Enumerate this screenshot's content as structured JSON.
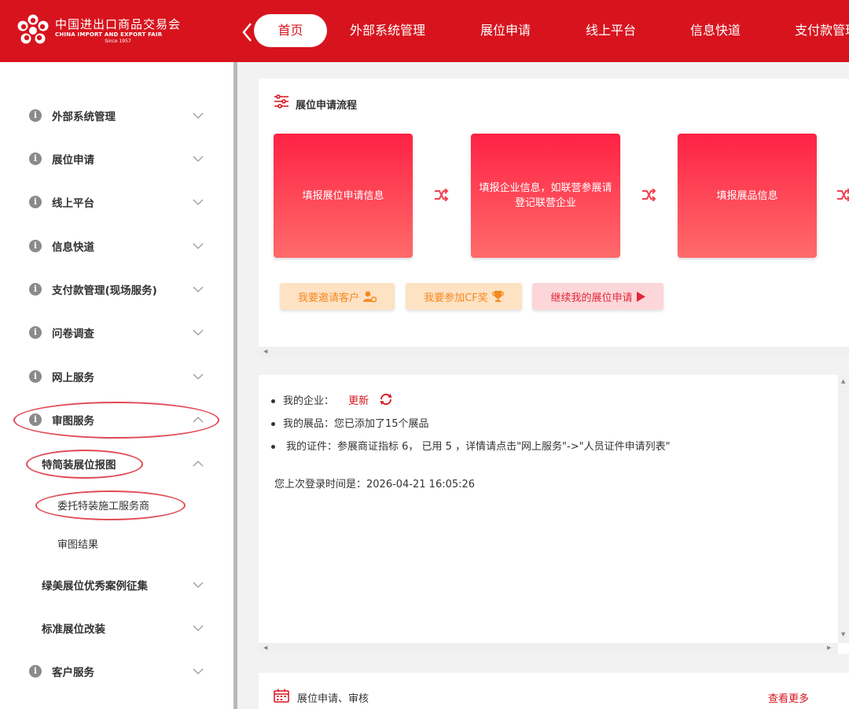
{
  "header": {
    "logo_cn": "中国进出口商品交易会",
    "logo_en": "CHINA IMPORT AND EXPORT FAIR",
    "logo_since": "Since 1957",
    "nav": [
      "首页",
      "外部系统管理",
      "展位申请",
      "线上平台",
      "信息快道",
      "支付款管理"
    ]
  },
  "sidebar": {
    "items": [
      {
        "label": "外部系统管理",
        "expanded": false
      },
      {
        "label": "展位申请",
        "expanded": false
      },
      {
        "label": "线上平台",
        "expanded": false
      },
      {
        "label": "信息快道",
        "expanded": false
      },
      {
        "label": "支付款管理(现场服务)",
        "expanded": false
      },
      {
        "label": "问卷调查",
        "expanded": false
      },
      {
        "label": "网上服务",
        "expanded": false
      },
      {
        "label": "审图服务",
        "expanded": true
      },
      {
        "label": "特简装展位报图",
        "expanded": true
      },
      {
        "label": "委托特装施工服务商"
      },
      {
        "label": "审图结果"
      },
      {
        "label": "绿美展位优秀案例征集",
        "expanded": false
      },
      {
        "label": "标准展位改装",
        "expanded": false
      },
      {
        "label": "客户服务",
        "expanded": false
      }
    ]
  },
  "flow": {
    "title": "展位申请流程",
    "steps": [
      "填报展位申请信息",
      "填报企业信息，如联营参展请登记联营企业",
      "填报展品信息"
    ],
    "buttons": [
      "我要邀请客户",
      "我要参加CF奖",
      "继续我的展位申请"
    ]
  },
  "info": {
    "company_label": "我的企业：",
    "company_link": "更新",
    "exhibits": "我的展品：您已添加了15个展品",
    "certs": "我的证件：参展商证指标 6， 已用 5 ，详情请点击\"网上服务\"->\"人员证件申请列表\"",
    "last_login": "您上次登录时间是：2026-04-21 16:05:26"
  },
  "review": {
    "title": "展位申请、审核",
    "more": "查看更多"
  },
  "colors": {
    "brand_red": "#d7141e",
    "step_gradient_top": "#fe2244",
    "step_gradient_bottom": "#ff6b6b",
    "annotation_oval": "#e04a55",
    "button_orange_bg": "#fde2c4",
    "button_orange_text": "#f5891f",
    "button_red_bg": "#fdd6d9"
  }
}
